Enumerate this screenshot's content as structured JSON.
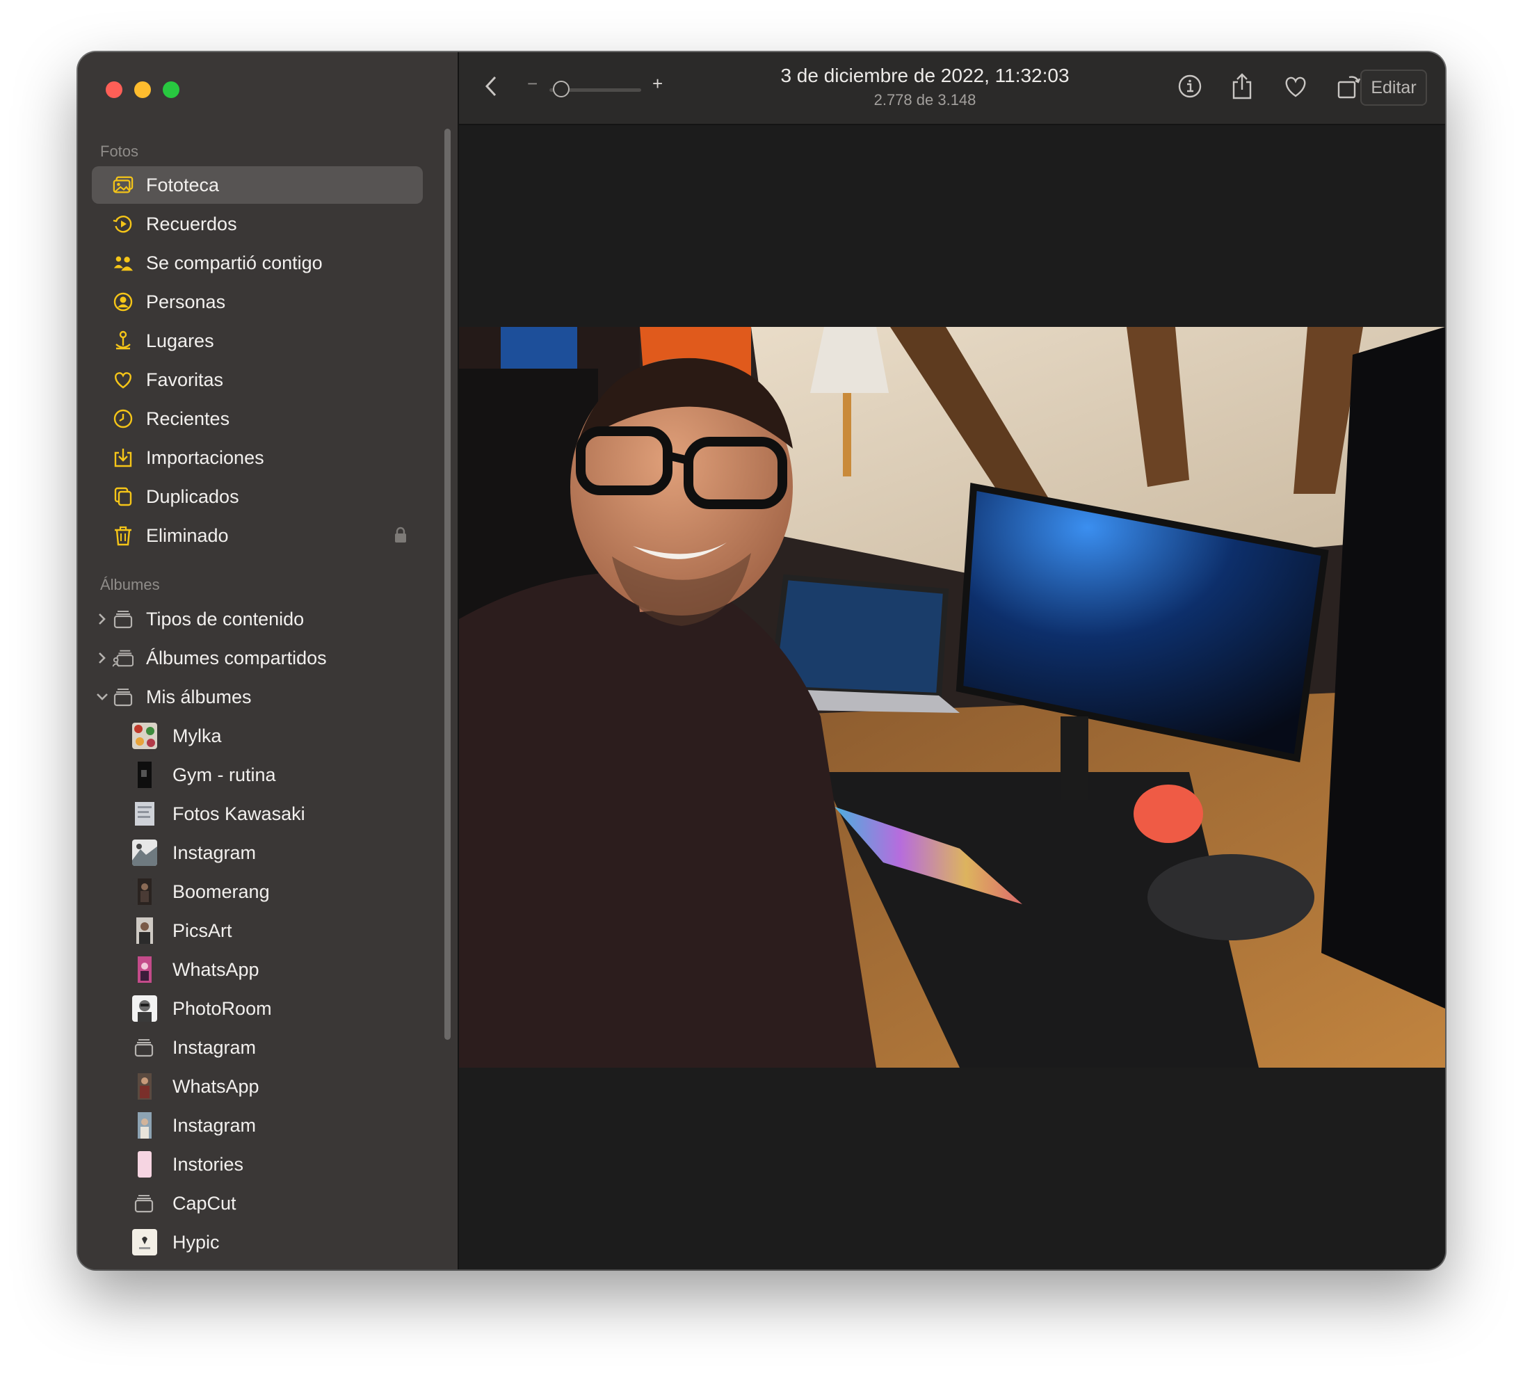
{
  "window": {
    "title": "3 de diciembre de 2022, 11:32:03",
    "subtitle": "2.778 de 3.148",
    "edit_label": "Editar",
    "zoom": {
      "minus": "−",
      "plus": "+",
      "level": 0.05
    }
  },
  "sidebar": {
    "section_photos": "Fotos",
    "photos_items": [
      {
        "label": "Fototeca",
        "icon": "photo-library-icon",
        "selected": true
      },
      {
        "label": "Recuerdos",
        "icon": "memories-icon"
      },
      {
        "label": "Se compartió contigo",
        "icon": "shared-with-you-icon"
      },
      {
        "label": "Personas",
        "icon": "people-icon"
      },
      {
        "label": "Lugares",
        "icon": "places-icon"
      },
      {
        "label": "Favoritas",
        "icon": "heart-icon"
      },
      {
        "label": "Recientes",
        "icon": "clock-icon"
      },
      {
        "label": "Importaciones",
        "icon": "import-icon"
      },
      {
        "label": "Duplicados",
        "icon": "duplicates-icon"
      },
      {
        "label": "Eliminado",
        "icon": "trash-icon",
        "locked": true
      }
    ],
    "section_albums": "Álbumes",
    "album_groups": [
      {
        "label": "Tipos de contenido",
        "expanded": false
      },
      {
        "label": "Álbumes compartidos",
        "expanded": false
      },
      {
        "label": "Mis álbumes",
        "expanded": true
      }
    ],
    "my_albums": [
      {
        "label": "Mylka"
      },
      {
        "label": "Gym - rutina"
      },
      {
        "label": "Fotos Kawasaki"
      },
      {
        "label": "Instagram"
      },
      {
        "label": "Boomerang"
      },
      {
        "label": "PicsArt"
      },
      {
        "label": "WhatsApp"
      },
      {
        "label": "PhotoRoom"
      },
      {
        "label": "Instagram"
      },
      {
        "label": "WhatsApp"
      },
      {
        "label": "Instagram"
      },
      {
        "label": "Instories"
      },
      {
        "label": "CapCut"
      },
      {
        "label": "Hypic"
      }
    ]
  },
  "colors": {
    "accent": "#f5c518",
    "sidebar_bg": "#3a3736",
    "toolbar_bg": "#2b2a29",
    "canvas_bg": "#1c1c1c"
  }
}
